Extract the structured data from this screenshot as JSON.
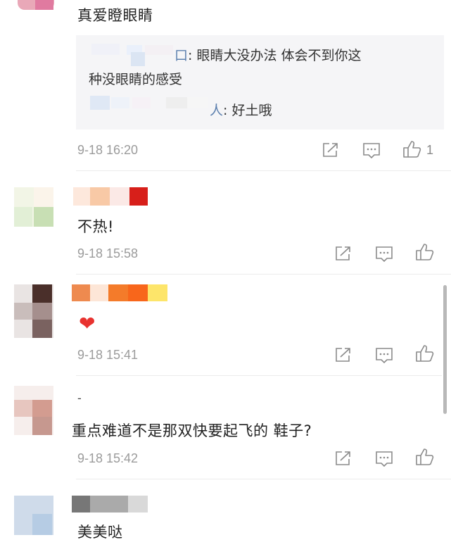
{
  "comments": [
    {
      "text": "真爱瞪眼睛",
      "time": "9-18 16:20",
      "like_count": "1",
      "replies": [
        {
          "name": "口",
          "text": ": 眼睛大没办法  体会不到你这",
          "text_cont": "种没眼睛的感受"
        },
        {
          "name": "人",
          "text": ": 好土哦"
        }
      ]
    },
    {
      "text": "不热!",
      "time": "9-18 15:58"
    },
    {
      "text": "",
      "emoji": "❤",
      "time": "9-18 15:41"
    },
    {
      "username_fragment": "-",
      "text": "重点难道不是那双快要起飞的 鞋子?",
      "time": "9-18 15:42"
    },
    {
      "text": "美美哒"
    }
  ],
  "icons": [
    "share-icon",
    "comment-icon",
    "like-icon"
  ],
  "colors": {
    "heart": "#e8322f",
    "reply_name": "#5b7fae",
    "time": "#9b9b9b"
  }
}
